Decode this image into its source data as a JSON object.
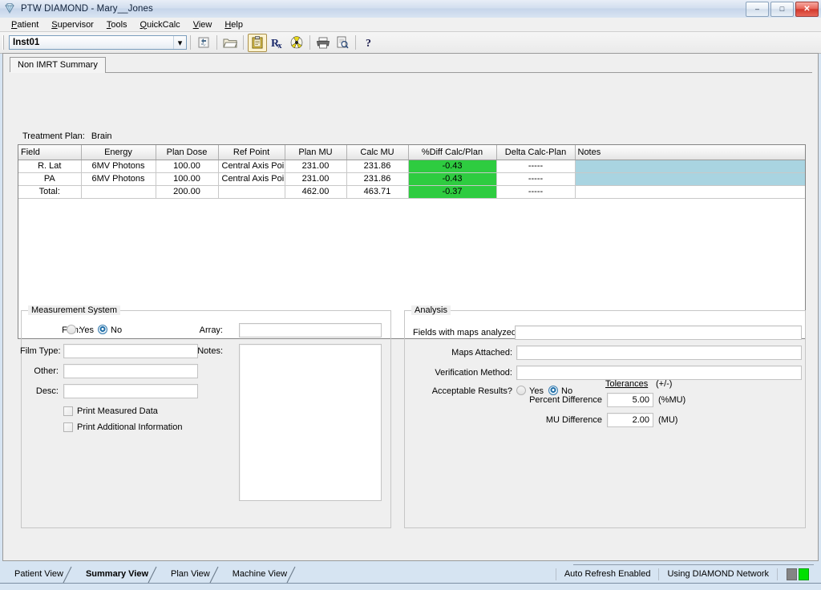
{
  "window": {
    "title": "PTW DIAMOND - Mary__Jones",
    "icon": "diamond-icon",
    "minimize_label": "–",
    "maximize_label": "□",
    "close_label": "✕"
  },
  "menubar": {
    "items": [
      {
        "label": "Patient",
        "accel": "P"
      },
      {
        "label": "Supervisor",
        "accel": "S"
      },
      {
        "label": "Tools",
        "accel": "T"
      },
      {
        "label": "QuickCalc",
        "accel": "Q"
      },
      {
        "label": "View",
        "accel": "V"
      },
      {
        "label": "Help",
        "accel": "H"
      }
    ]
  },
  "toolbar": {
    "institution_combo": {
      "value": "Inst01",
      "arrow": "▾"
    },
    "buttons": [
      {
        "name": "refresh-sync-icon",
        "glyph": "↺"
      },
      {
        "name": "open-folder-icon",
        "glyph": "🗀"
      },
      {
        "name": "clipboard-icon",
        "glyph": "📋",
        "active": true
      },
      {
        "name": "prescription-rx-icon",
        "glyph": "Rx"
      },
      {
        "name": "radiation-icon",
        "glyph": "☢"
      },
      {
        "name": "print-icon",
        "glyph": "🖨"
      },
      {
        "name": "print-preview-icon",
        "glyph": "🔍"
      },
      {
        "name": "help-icon",
        "glyph": "?"
      }
    ]
  },
  "page": {
    "tab_label": "Non IMRT Summary",
    "treatment_plan_label": "Treatment Plan:",
    "treatment_plan_value": "Brain"
  },
  "grid": {
    "columns": [
      "Field",
      "Energy",
      "Plan Dose",
      "Ref Point",
      "Plan MU",
      "Calc MU",
      "%Diff Calc/Plan",
      "Delta Calc-Plan",
      "Notes"
    ],
    "rows": [
      {
        "field": "R. Lat",
        "energy": "6MV Photons",
        "plan_dose": "100.00",
        "ref_point": "Central Axis Poi..",
        "plan_mu": "231.00",
        "calc_mu": "231.86",
        "pct_diff": "-0.43",
        "delta": "-----",
        "notes": "",
        "pct_diff_color": "#2ecc40",
        "notes_color": "#a9d4e1"
      },
      {
        "field": "PA",
        "energy": "6MV Photons",
        "plan_dose": "100.00",
        "ref_point": "Central Axis Poi..",
        "plan_mu": "231.00",
        "calc_mu": "231.86",
        "pct_diff": "-0.43",
        "delta": "-----",
        "notes": "",
        "pct_diff_color": "#2ecc40",
        "notes_color": "#a9d4e1"
      },
      {
        "field": "Total:",
        "energy": "",
        "plan_dose": "200.00",
        "ref_point": "",
        "plan_mu": "462.00",
        "calc_mu": "463.71",
        "pct_diff": "-0.37",
        "delta": "-----",
        "notes": "",
        "pct_diff_color": "#2ecc40",
        "notes_color": "#ffffff"
      }
    ]
  },
  "measurement_system": {
    "legend": "Measurement System",
    "film_label": "Film:",
    "film_yes_label": "Yes",
    "film_no_label": "No",
    "film_value": "No",
    "film_type_label": "Film Type:",
    "film_type_value": "",
    "other_label": "Other:",
    "other_value": "",
    "desc_label": "Desc:",
    "desc_value": "",
    "print_measured_label": "Print Measured Data",
    "print_measured_checked": false,
    "print_additional_label": "Print Additional Information",
    "print_additional_checked": false,
    "array_label": "Array:",
    "array_value": "",
    "notes_label": "Notes:",
    "notes_value": ""
  },
  "analysis": {
    "legend": "Analysis",
    "fields_maps_label": "Fields with maps analyzed:",
    "fields_maps_value": "",
    "maps_attached_label": "Maps Attached:",
    "maps_attached_value": "",
    "verification_label": "Verification Method:",
    "verification_value": "",
    "acceptable_label": "Acceptable Results?",
    "acceptable_yes_label": "Yes",
    "acceptable_no_label": "No",
    "acceptable_value": "No",
    "tolerances_label": "Tolerances",
    "tolerances_sign": "(+/-)",
    "percent_diff_label": "Percent Difference",
    "percent_diff_value": "5.00",
    "percent_diff_unit": "(%MU)",
    "mu_diff_label": "MU Difference",
    "mu_diff_value": "2.00",
    "mu_diff_unit": "(MU)"
  },
  "bottom": {
    "tabs": [
      {
        "label": "Patient View",
        "selected": false
      },
      {
        "label": "Summary View",
        "selected": true
      },
      {
        "label": "Plan View",
        "selected": false
      },
      {
        "label": "Machine View",
        "selected": false
      }
    ],
    "status": {
      "auto_refresh": "Auto Refresh Enabled",
      "network": "Using DIAMOND Network",
      "led_inactive_color": "#848484",
      "led_active_color": "#00e000"
    }
  }
}
